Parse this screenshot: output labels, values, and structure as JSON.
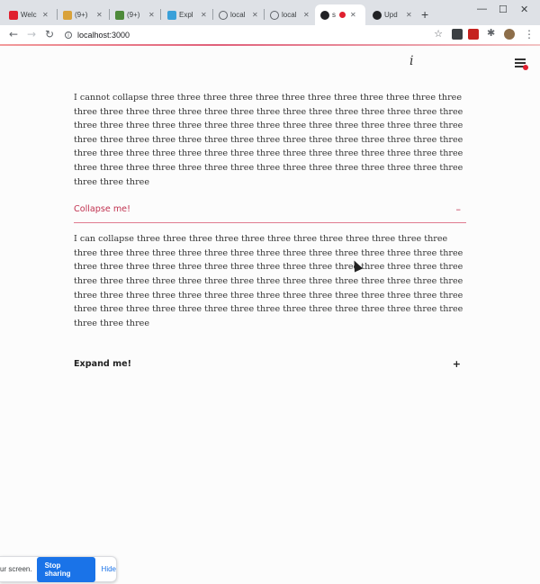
{
  "browser": {
    "tabs": [
      {
        "title": "Welc",
        "color": "#e0202f"
      },
      {
        "title": "(9+)",
        "color": "#d9a23a"
      },
      {
        "title": "(9+)",
        "color": "#4e8a3a"
      },
      {
        "title": "Expl",
        "color": "#3aa0d9"
      },
      {
        "title": "local",
        "color": "#5f6368"
      },
      {
        "title": "local",
        "color": "#5f6368"
      },
      {
        "title": "s",
        "color": "#202124"
      },
      {
        "title": "Upd",
        "color": "#202124"
      }
    ],
    "new_tab_label": "+",
    "url": "localhost:3000"
  },
  "page": {
    "info_glyph": "i",
    "intro_text": "I cannot collapse three three three three three three three three three three three three three three three three three three three three three three three three three three three three three three three three three three three three three three three three three three three three three three three three three three three three three three three three three three three three three three three three three three three three three three three three three three three three three three three three three three three three three three three three three three",
    "accordions": [
      {
        "title": "Collapse me!",
        "toggle": "–",
        "open": true,
        "body": "I can collapse three three three three three three three three three three three three three three three three three three three three three three three three three three three three three three three three three three three three three three three three three three three three three three three three three three three three three three three three three three three three three three three three three three three three three three three three three three three three three three three three three three three three three three three three three three"
      },
      {
        "title": "Expand me!",
        "toggle": "+",
        "open": false
      }
    ]
  },
  "screen_share": {
    "message": "ur screen.",
    "stop_label": "Stop sharing",
    "hide_label": "Hide"
  },
  "colors": {
    "accent": "#c0314f",
    "share_button": "#1a73e8"
  }
}
